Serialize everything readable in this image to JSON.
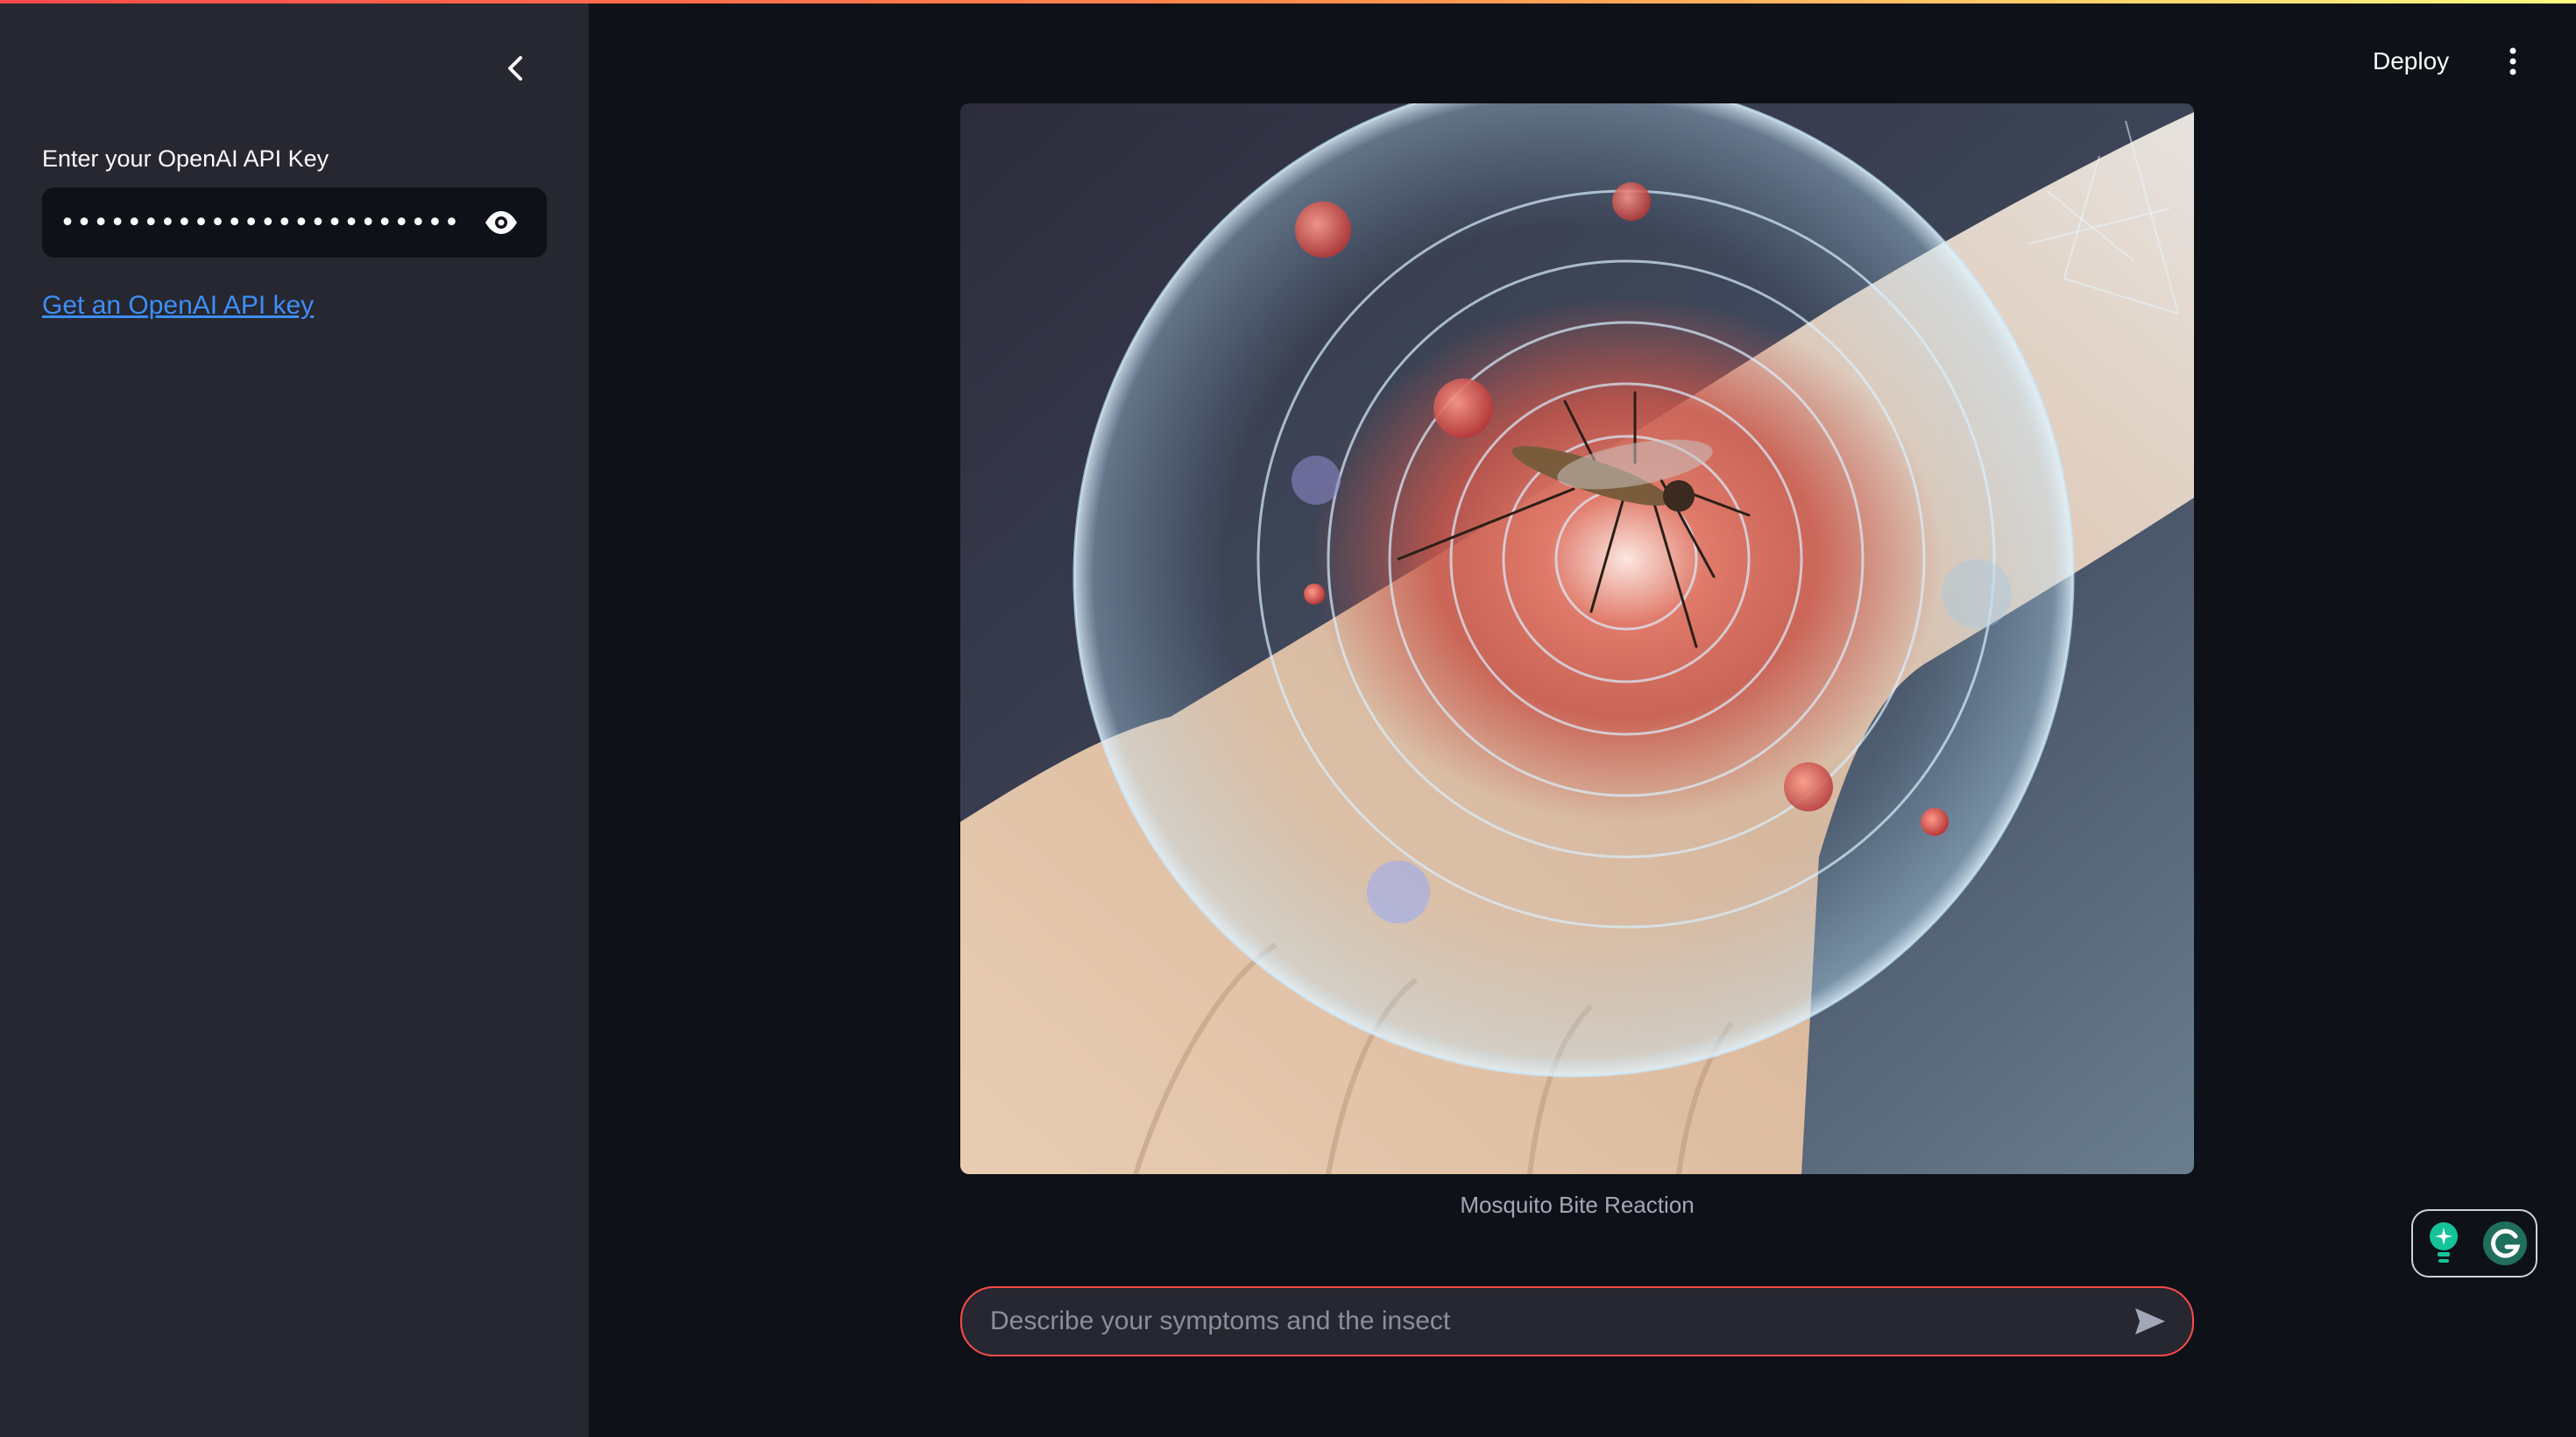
{
  "sidebar": {
    "api_key_label": "Enter your OpenAI API Key",
    "api_key_value": "••••••••••••••••••••••••••••••••••••••••••••••••",
    "api_key_link": "Get an OpenAI API key",
    "collapse_icon": "chevron-left-icon",
    "reveal_icon": "eye-icon"
  },
  "header": {
    "deploy_label": "Deploy",
    "menu_icon": "more-vertical-icon"
  },
  "main": {
    "image_caption": "Mosquito Bite Reaction",
    "chat_input": {
      "placeholder": "Describe your symptoms and the insect",
      "value": ""
    },
    "send_icon": "send-icon"
  },
  "extension_widget": {
    "icons": [
      "lightbulb-icon",
      "grammarly-icon"
    ]
  },
  "colors": {
    "app_bg": "#0e1117",
    "sidebar_bg": "#262730",
    "accent": "#ff4b4b",
    "link": "#3d8ef7",
    "text": "#fafafa",
    "caption": "#a3a8b8"
  }
}
